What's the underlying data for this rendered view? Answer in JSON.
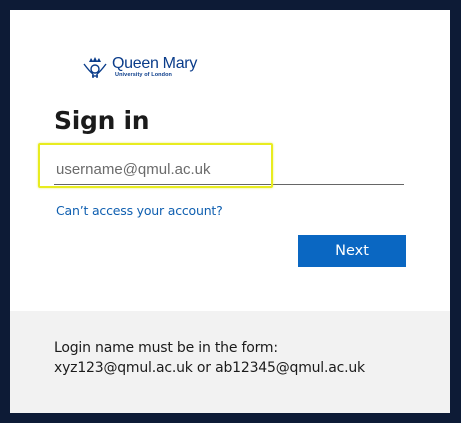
{
  "logo": {
    "name": "Queen Mary",
    "subtitle": "University of London",
    "icon": "crown-keys-crest-icon"
  },
  "signin": {
    "title": "Sign in",
    "username_placeholder": "username@qmul.ac.uk",
    "username_value": "",
    "cant_access_link": "Can’t access your account?",
    "next_label": "Next"
  },
  "footer": {
    "hint_line1": "Login name must be in the form:",
    "hint_line2": "xyz123@qmul.ac.uk or ab12345@qmul.ac.uk"
  },
  "colors": {
    "page_background": "#0d1b36",
    "brand_blue": "#0a3c8a",
    "button_blue": "#0a67c2",
    "link_blue": "#0f5fb0",
    "highlight_yellow": "#e8ec1f",
    "footer_background": "#f2f2f2"
  }
}
